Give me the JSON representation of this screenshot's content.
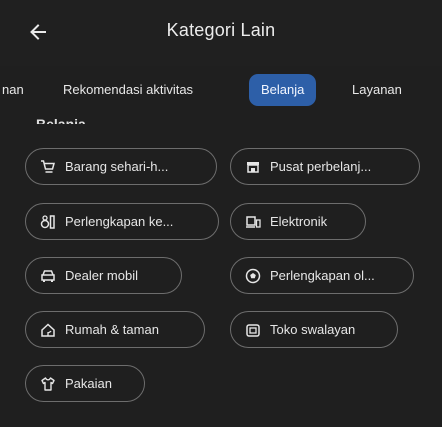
{
  "header": {
    "title": "Kategori Lain",
    "back_icon": "arrow-left-icon"
  },
  "tabs": [
    {
      "label": "nan",
      "active": false
    },
    {
      "label": "Rekomendasi aktivitas",
      "active": false
    },
    {
      "label": "Belanja",
      "active": true
    },
    {
      "label": "Layanan",
      "active": false
    }
  ],
  "section": {
    "label": "Belanja"
  },
  "chips": [
    {
      "label": "Barang sehari-h...",
      "icon": "shopping-cart-icon"
    },
    {
      "label": "Pusat perbelanj...",
      "icon": "store-icon"
    },
    {
      "label": "Perlengkapan ke...",
      "icon": "beauty-products-icon"
    },
    {
      "label": "Elektronik",
      "icon": "devices-icon"
    },
    {
      "label": "Dealer mobil",
      "icon": "car-icon"
    },
    {
      "label": "Perlengkapan ol...",
      "icon": "soccer-ball-icon"
    },
    {
      "label": "Rumah & taman",
      "icon": "home-garden-icon"
    },
    {
      "label": "Toko swalayan",
      "icon": "grocery-store-icon"
    },
    {
      "label": "Pakaian",
      "icon": "shirt-icon"
    }
  ],
  "colors": {
    "background": "#1f1f1f",
    "active_tab": "#2d5fa8",
    "chip_border": "#6d6d6d",
    "text": "#e6e6e6"
  }
}
